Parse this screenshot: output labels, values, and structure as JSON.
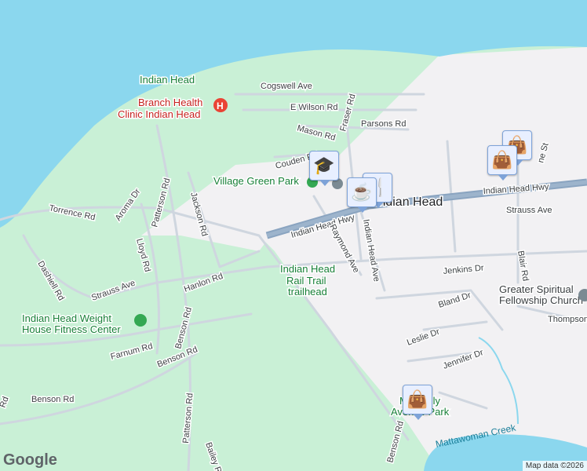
{
  "map": {
    "place_labels": {
      "town": "Indian Head",
      "indian_head_area": "Indian Head",
      "clinic": "Branch Health Clinic Indian Head",
      "clinic_line1": "Branch Health",
      "clinic_line2": "Clinic Indian Head",
      "village_green": "Village Green Park",
      "rail_trail_1": "Indian Head",
      "rail_trail_2": "Rail Trail",
      "rail_trail_3": "trailhead",
      "fitness_1": "Indian Head Weight",
      "fitness_2": "House Fitness Center",
      "church_1": "Greater Spiritual",
      "church_2": "Fellowship Church",
      "park_bottom_1": "Mattingly",
      "park_bottom_2": "Avenue Park",
      "creek": "Mattawoman Creek"
    },
    "roads": {
      "cogswell": "Cogswell Ave",
      "wilson": "E Wilson Rd",
      "parsons": "Parsons Rd",
      "mason": "Mason Rd",
      "fraser": "Fraser Rd",
      "couden": "Couden Rd",
      "hwy1": "Indian Head Hwy",
      "hwy2": "Indian Head Hwy",
      "strauss_e": "Strauss Ave",
      "torrence": "Torrence Rd",
      "aroma": "Aroma Dr",
      "patterson": "Patterson Rd",
      "jackson": "Jackson Rd",
      "lloyd": "Lloyd Rd",
      "dashiell": "Dashiell Rd",
      "strauss_w": "Strauss Ave",
      "hanlon": "Hanlon Rd",
      "raymond": "Raymond Ave",
      "ih_ave": "Indian Head Ave",
      "jenkins": "Jenkins Dr",
      "bland": "Bland Dr",
      "blair": "Blair Rd",
      "thompson": "Thompson",
      "leslie": "Leslie Dr",
      "jennifer": "Jennifer Dr",
      "farnum": "Farnum Rd",
      "benson1": "Benson Rd",
      "benson2": "Benson Rd",
      "benson3": "Benson Rd",
      "patterson2": "Patterson Rd",
      "bailey": "Bailey R",
      "rd_left": "Rd",
      "st": "ne St"
    },
    "pins": [
      {
        "icon": "graduation-cap-icon",
        "glyph": "🎓"
      },
      {
        "icon": "restaurant-icon",
        "glyph": "🍴"
      },
      {
        "icon": "coffee-icon",
        "glyph": "☕"
      },
      {
        "icon": "shopping-bag-icon",
        "glyph": "👜"
      },
      {
        "icon": "shopping-bag-icon",
        "glyph": "👜"
      },
      {
        "icon": "shopping-bag-icon",
        "glyph": "👜"
      }
    ],
    "attribution": "Map data ©2026",
    "logo": "Google",
    "colors": {
      "water": "#8bd7ee",
      "park": "#c9f0d6",
      "urban": "#f2f1f3",
      "highway": "#8aa4c0"
    }
  }
}
